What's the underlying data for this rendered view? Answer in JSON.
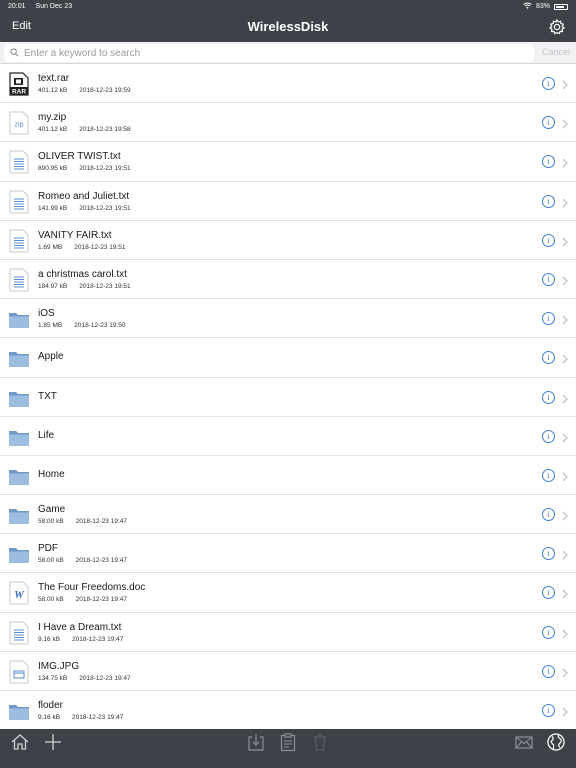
{
  "status_bar": {
    "time": "20:01",
    "date": "Sun Dec 23",
    "battery": "83%",
    "battery_level": 0.83
  },
  "nav": {
    "edit_label": "Edit",
    "title": "WirelessDisk",
    "settings_icon": "gear-icon"
  },
  "search": {
    "placeholder": "Enter a keyword to search",
    "value": "",
    "cancel_label": "Cancel"
  },
  "files": [
    {
      "name": "text.rar",
      "size": "401.12 kB",
      "date": "2018-12-23 19:59",
      "icon": "rar-file-icon"
    },
    {
      "name": "my.zip",
      "size": "401.12 kB",
      "date": "2018-12-23 19:58",
      "icon": "zip-file-icon"
    },
    {
      "name": "OLIVER TWIST.txt",
      "size": "890.95 kB",
      "date": "2018-12-23 19:51",
      "icon": "text-file-icon"
    },
    {
      "name": "Romeo and Juliet.txt",
      "size": "141.99 kB",
      "date": "2018-12-23 19:51",
      "icon": "text-file-icon"
    },
    {
      "name": "VANITY FAIR.txt",
      "size": "1.69 MB",
      "date": "2018-12-23 19:51",
      "icon": "text-file-icon"
    },
    {
      "name": "a christmas carol.txt",
      "size": "184.97 kB",
      "date": "2018-12-23 19:51",
      "icon": "text-file-icon"
    },
    {
      "name": "iOS",
      "size": "1.85 MB",
      "date": "2018-12-23 19:50",
      "icon": "folder-icon"
    },
    {
      "name": "Apple",
      "size": "",
      "date": "",
      "icon": "folder-icon"
    },
    {
      "name": "TXT",
      "size": "",
      "date": "",
      "icon": "folder-icon"
    },
    {
      "name": "Life",
      "size": "",
      "date": "",
      "icon": "folder-icon"
    },
    {
      "name": "Home",
      "size": "",
      "date": "",
      "icon": "folder-icon"
    },
    {
      "name": "Game",
      "size": "58.00 kB",
      "date": "2018-12-23 19:47",
      "icon": "folder-icon"
    },
    {
      "name": "PDF",
      "size": "58.00 kB",
      "date": "2018-12-23 19:47",
      "icon": "folder-icon"
    },
    {
      "name": "The Four Freedoms.doc",
      "size": "58.00 kB",
      "date": "2018-12-23 19:47",
      "icon": "word-file-icon"
    },
    {
      "name": "I Have a Dream.txt",
      "size": "9.16 kB",
      "date": "2018-12-23 19:47",
      "icon": "text-file-icon"
    },
    {
      "name": "IMG.JPG",
      "size": "134.75 kB",
      "date": "2018-12-23 19:47",
      "icon": "image-file-icon"
    },
    {
      "name": "floder",
      "size": "9.16 kB",
      "date": "2018-12-23 19:47",
      "icon": "folder-icon"
    }
  ],
  "toolbar": {
    "items": [
      "home-icon",
      "add-icon",
      "download-icon",
      "clipboard-icon",
      "trash-icon",
      "mail-icon",
      "globe-icon"
    ]
  },
  "colors": {
    "bar_bg": "#3d4249",
    "accent": "#3c7ed8",
    "folder": "#7da7cf"
  }
}
